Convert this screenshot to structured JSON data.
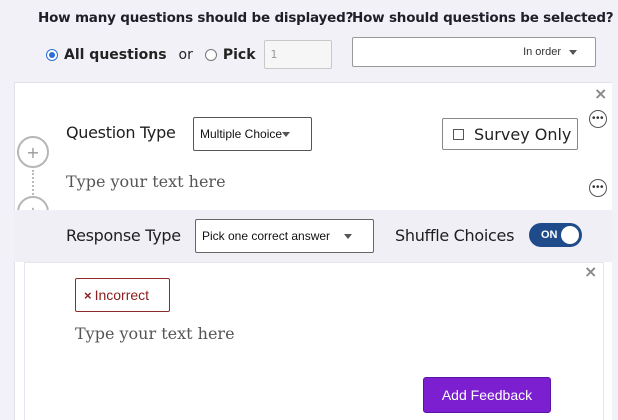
{
  "display": {
    "question": "How many questions should be displayed?",
    "all_label": "All questions",
    "or_label": "or",
    "pick_label": "Pick",
    "pick_value": "1"
  },
  "selection": {
    "question": "How should questions be selected?",
    "value": "In order"
  },
  "question": {
    "type_label": "Question Type",
    "type_value": "Multiple Choice",
    "survey_label": "Survey Only",
    "text_placeholder": "Type your text here"
  },
  "response": {
    "type_label": "Response Type",
    "type_value": "Pick one correct answer",
    "shuffle_label": "Shuffle Choices",
    "shuffle_state": "ON"
  },
  "feedback": {
    "tag_label": "Incorrect",
    "text_placeholder": "Type your text here",
    "add_label": "Add Feedback"
  },
  "icons": {
    "add": "+",
    "close": "×",
    "more": "•••"
  },
  "colors": {
    "accent": "#7b1fd1",
    "toggle": "#1f4b8a",
    "incorrect": "#8b2020",
    "radio": "#2a6fd6"
  }
}
